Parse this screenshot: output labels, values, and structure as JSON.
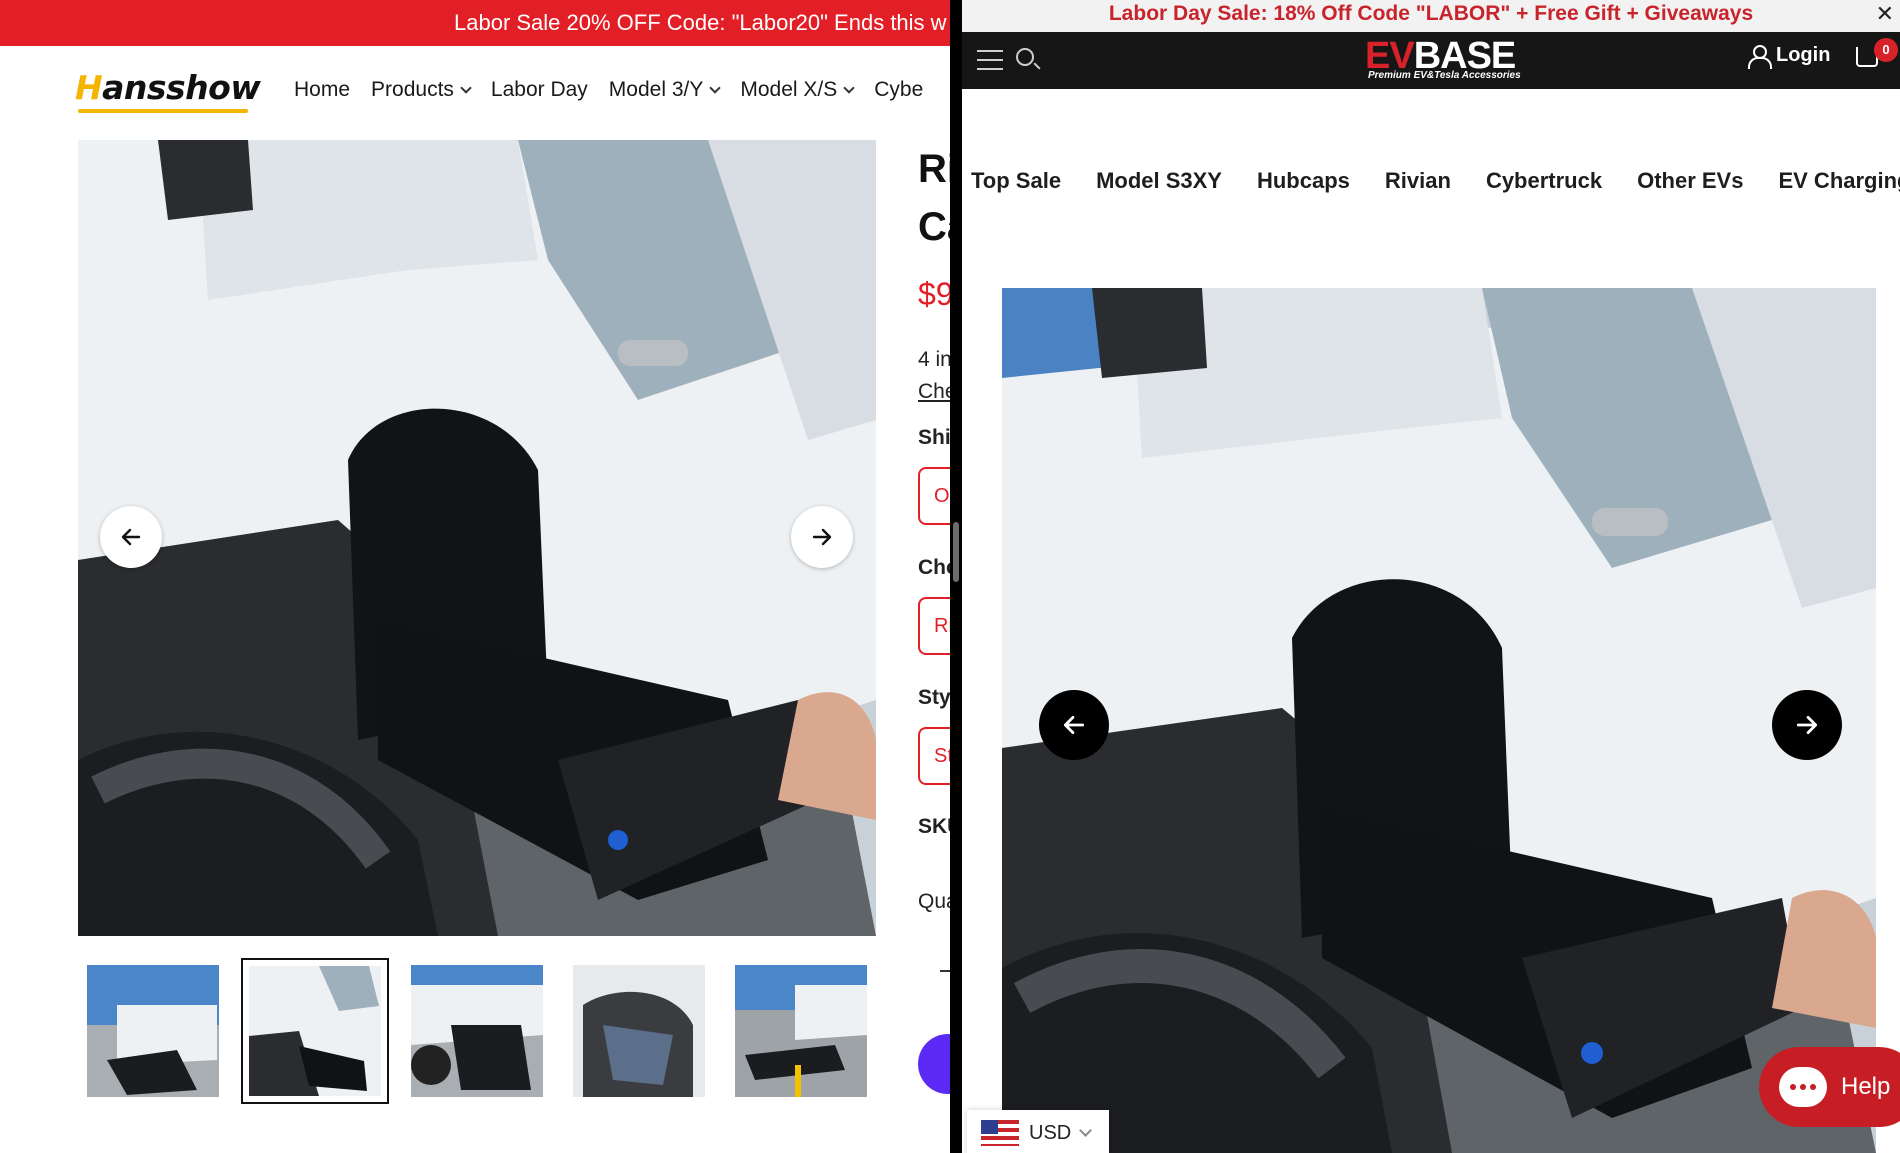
{
  "left": {
    "banner": "Labor Sale 20% OFF Code: \"Labor20\" Ends this w",
    "logo": {
      "lead": "H",
      "rest": "ansshow"
    },
    "nav": [
      {
        "label": "Home",
        "dropdown": false
      },
      {
        "label": "Products",
        "dropdown": true
      },
      {
        "label": "Labor Day",
        "dropdown": false
      },
      {
        "label": "Model 3/Y",
        "dropdown": true
      },
      {
        "label": "Model X/S",
        "dropdown": true
      },
      {
        "label": "Cybe",
        "dropdown": false
      }
    ],
    "product": {
      "title_line1": "Ri",
      "title_line2": "Ca",
      "price": "$9",
      "installments": "4 in",
      "check_link": "Che",
      "shipping_label": "Shi",
      "shipping_option": "O",
      "choose_label": "Cho",
      "choose_option": "Ri",
      "style_label": "Sty",
      "style_option": "St",
      "sku_label": "SKU",
      "quantity_label": "Qua"
    },
    "thumbnails": 5,
    "active_thumbnail": 2
  },
  "right": {
    "banner": "Labor Day Sale: 18% Off Code \"LABOR\" + Free Gift + Giveaways",
    "close": "✕",
    "logo": {
      "ev": "EV",
      "base": "BASE",
      "tagline": "Premium EV&Tesla Accessories"
    },
    "login": "Login",
    "cart_count": "0",
    "nav": [
      "Top Sale",
      "Model S3XY",
      "Hubcaps",
      "Rivian",
      "Cybertruck",
      "Other EVs",
      "EV Charging"
    ],
    "help": "Help",
    "currency": "USD"
  },
  "icons": {
    "left_prev": "arrow-left-icon",
    "left_next": "arrow-right-icon",
    "right_prev": "arrow-left-icon",
    "right_next": "arrow-right-icon",
    "menu": "hamburger-icon",
    "search": "search-icon",
    "user": "user-icon",
    "cart": "cart-icon",
    "chat": "chat-icon"
  },
  "colors": {
    "hansshow_red": "#e21f26",
    "hansshow_yellow": "#f5b400",
    "evbase_red": "#c8242b",
    "evbase_header": "#161616",
    "cta_purple": "#5b2bf5"
  }
}
